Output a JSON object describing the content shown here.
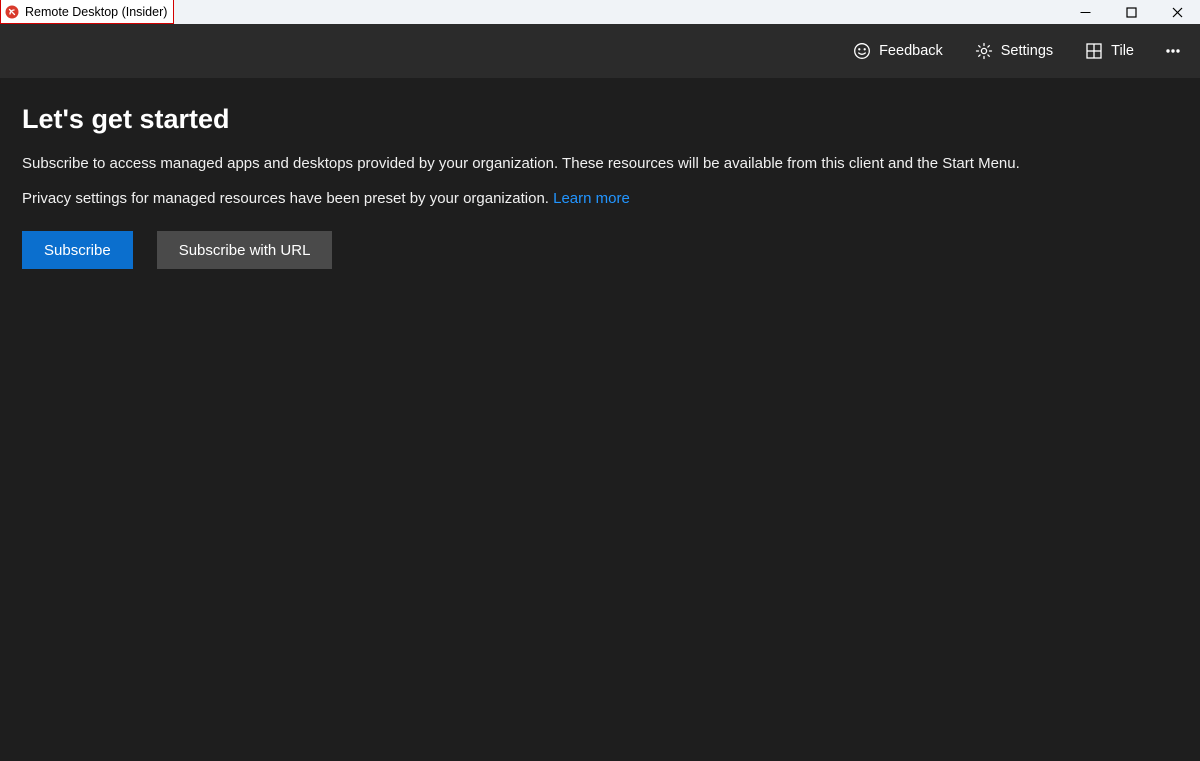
{
  "window": {
    "title": "Remote Desktop (Insider)"
  },
  "commandbar": {
    "feedback": "Feedback",
    "settings": "Settings",
    "tile": "Tile"
  },
  "main": {
    "heading": "Let's get started",
    "paragraph1": "Subscribe to access managed apps and desktops provided by your organization. These resources will be available from this client and the Start Menu.",
    "paragraph2_prefix": "Privacy settings for managed resources have been preset by your organization. ",
    "learn_more": "Learn more",
    "subscribe_button": "Subscribe",
    "subscribe_url_button": "Subscribe with URL"
  }
}
